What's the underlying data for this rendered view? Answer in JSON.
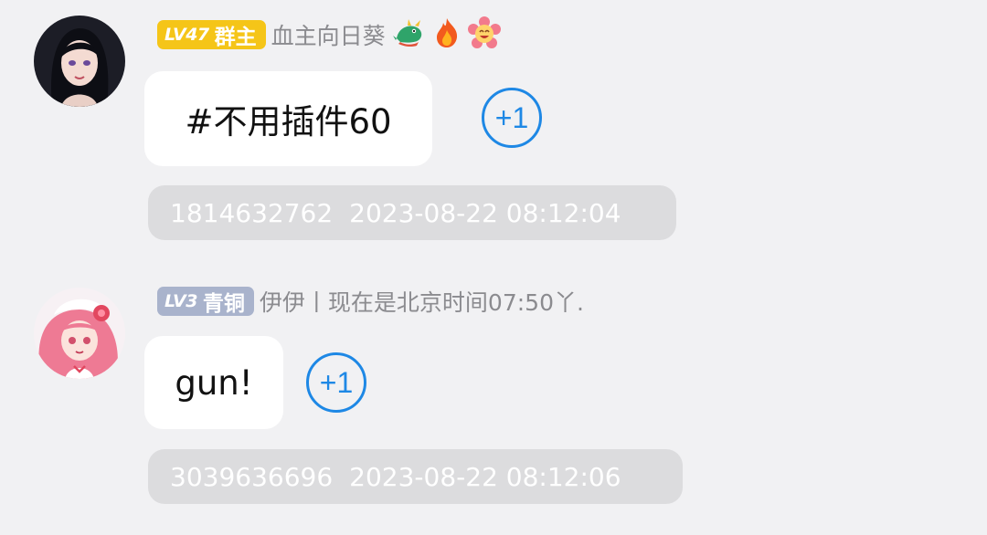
{
  "messages": [
    {
      "level": "LV47",
      "role": "群主",
      "badge_color": "#f5c518",
      "nickname": "血主向日葵",
      "nickname_icons": [
        "dragon-icon",
        "fire-icon",
        "flower-icon"
      ],
      "text": "#不用插件60",
      "plus_label": "+1",
      "user_id": "1814632762",
      "timestamp": "2023-08-22 08:12:04"
    },
    {
      "level": "LV3",
      "role": "青铜",
      "badge_color": "#a9b3cc",
      "nickname": "伊伊丨现在是北京时间07:50丫.",
      "nickname_icons": [],
      "text": "gun!",
      "plus_label": "+1",
      "user_id": "3039636696",
      "timestamp": "2023-08-22 08:12:06"
    }
  ],
  "colors": {
    "background": "#f1f1f3",
    "accent_blue": "#1e88e5",
    "meta_bg": "#dcdcde",
    "nickname": "#8b8b8f"
  }
}
